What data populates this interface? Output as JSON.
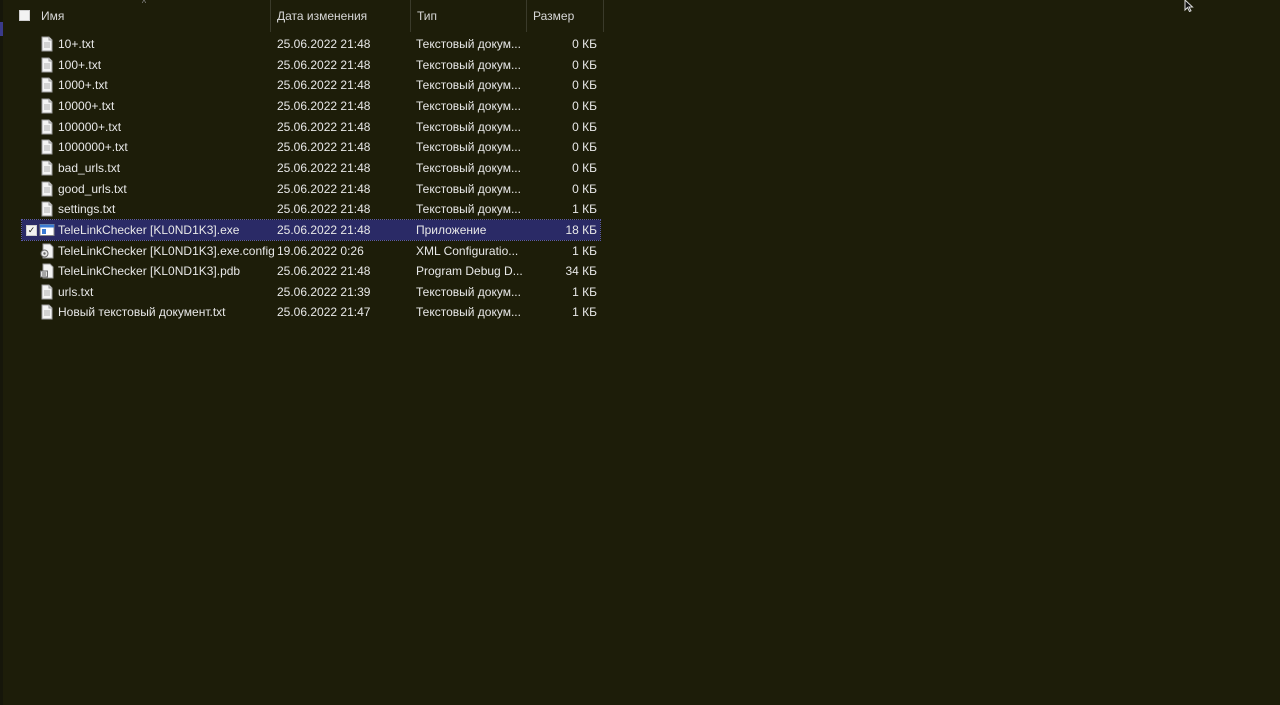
{
  "columns": {
    "name": "Имя",
    "date": "Дата изменения",
    "type": "Тип",
    "size": "Размер"
  },
  "files": [
    {
      "name": "10+.txt",
      "date": "25.06.2022 21:48",
      "type": "Текстовый докум...",
      "size": "0 КБ",
      "icon": "text-file-icon",
      "selected": false
    },
    {
      "name": "100+.txt",
      "date": "25.06.2022 21:48",
      "type": "Текстовый докум...",
      "size": "0 КБ",
      "icon": "text-file-icon",
      "selected": false
    },
    {
      "name": "1000+.txt",
      "date": "25.06.2022 21:48",
      "type": "Текстовый докум...",
      "size": "0 КБ",
      "icon": "text-file-icon",
      "selected": false
    },
    {
      "name": "10000+.txt",
      "date": "25.06.2022 21:48",
      "type": "Текстовый докум...",
      "size": "0 КБ",
      "icon": "text-file-icon",
      "selected": false
    },
    {
      "name": "100000+.txt",
      "date": "25.06.2022 21:48",
      "type": "Текстовый докум...",
      "size": "0 КБ",
      "icon": "text-file-icon",
      "selected": false
    },
    {
      "name": "1000000+.txt",
      "date": "25.06.2022 21:48",
      "type": "Текстовый докум...",
      "size": "0 КБ",
      "icon": "text-file-icon",
      "selected": false
    },
    {
      "name": "bad_urls.txt",
      "date": "25.06.2022 21:48",
      "type": "Текстовый докум...",
      "size": "0 КБ",
      "icon": "text-file-icon",
      "selected": false
    },
    {
      "name": "good_urls.txt",
      "date": "25.06.2022 21:48",
      "type": "Текстовый докум...",
      "size": "0 КБ",
      "icon": "text-file-icon",
      "selected": false
    },
    {
      "name": "settings.txt",
      "date": "25.06.2022 21:48",
      "type": "Текстовый докум...",
      "size": "1 КБ",
      "icon": "text-file-icon",
      "selected": false
    },
    {
      "name": "TeleLinkChecker [KL0ND1K3].exe",
      "date": "25.06.2022 21:48",
      "type": "Приложение",
      "size": "18 КБ",
      "icon": "application-icon",
      "selected": true
    },
    {
      "name": "TeleLinkChecker [KL0ND1K3].exe.config",
      "date": "19.06.2022 0:26",
      "type": "XML Configuratio...",
      "size": "1 КБ",
      "icon": "config-file-icon",
      "selected": false
    },
    {
      "name": "TeleLinkChecker [KL0ND1K3].pdb",
      "date": "25.06.2022 21:48",
      "type": "Program Debug D...",
      "size": "34 КБ",
      "icon": "debug-file-icon",
      "selected": false
    },
    {
      "name": "urls.txt",
      "date": "25.06.2022 21:39",
      "type": "Текстовый докум...",
      "size": "1 КБ",
      "icon": "text-file-icon",
      "selected": false
    },
    {
      "name": "Новый текстовый документ.txt",
      "date": "25.06.2022 21:47",
      "type": "Текстовый докум...",
      "size": "1 КБ",
      "icon": "text-file-icon",
      "selected": false
    }
  ],
  "colors": {
    "background": "#1d1d09",
    "selection": "#2a2a66",
    "text": "#e8e8e8"
  }
}
